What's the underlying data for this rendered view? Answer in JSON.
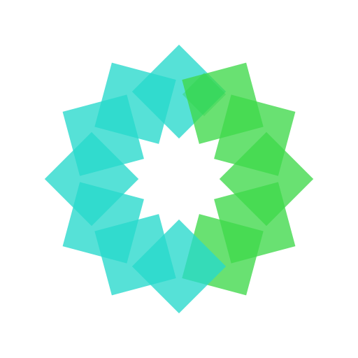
{
  "logo": {
    "name": "rotating-squares-logo",
    "square_count": 12,
    "colors": {
      "teal": "#27D9CC",
      "green": "#3FD94A",
      "teal_mixed": "#1ECAB3",
      "green_mixed": "#27D44B"
    }
  }
}
